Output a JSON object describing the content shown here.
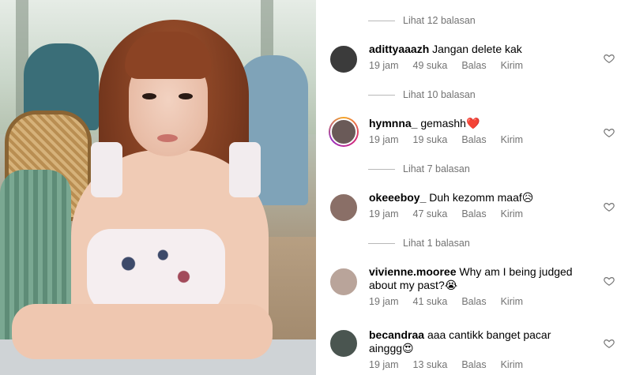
{
  "replies": [
    {
      "label": "Lihat 12 balasan"
    },
    {
      "label": "Lihat 10 balasan"
    },
    {
      "label": "Lihat 7 balasan"
    },
    {
      "label": "Lihat 1 balasan"
    }
  ],
  "comments": [
    {
      "username": "adittyaaazh",
      "text": "Jangan delete kak",
      "emoji": "",
      "time": "19 jam",
      "likes": "49 suka",
      "reply": "Balas",
      "send": "Kirim",
      "avatar_color": "#3b3b3b",
      "story_ring": false
    },
    {
      "username": "hymnna_",
      "text": "gemashh",
      "emoji": "❤️",
      "time": "19 jam",
      "likes": "19 suka",
      "reply": "Balas",
      "send": "Kirim",
      "avatar_color": "#6a5a58",
      "story_ring": true
    },
    {
      "username": "okeeeboy_",
      "text": "Duh kezomm maaf",
      "emoji": "😥",
      "time": "19 jam",
      "likes": "47 suka",
      "reply": "Balas",
      "send": "Kirim",
      "avatar_color": "#8a6f67",
      "story_ring": false
    },
    {
      "username": "vivienne.mooree",
      "text": "Why am I being judged about my past?",
      "emoji": "😭",
      "time": "19 jam",
      "likes": "41 suka",
      "reply": "Balas",
      "send": "Kirim",
      "avatar_color": "#b9a49a",
      "story_ring": false
    },
    {
      "username": "becandraa",
      "text": "aaa cantikk banget pacar ainggg",
      "emoji": "😍",
      "time": "19 jam",
      "likes": "13 suka",
      "reply": "Balas",
      "send": "Kirim",
      "avatar_color": "#4a5550",
      "story_ring": false
    }
  ],
  "icons": {
    "like": "heart-outline-icon"
  },
  "colors": {
    "meta": "#737373",
    "text": "#000000",
    "divider": "#b8b8b8"
  }
}
